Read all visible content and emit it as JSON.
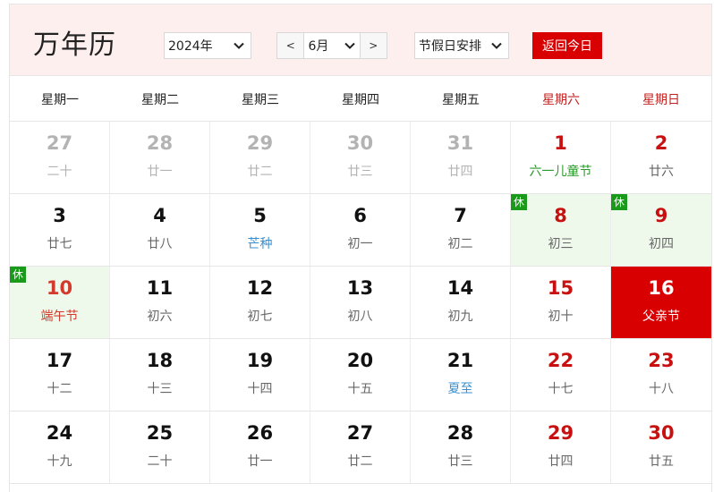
{
  "header": {
    "title": "万年历",
    "year_value": "2024年",
    "prev_month": "<",
    "month_value": "6月",
    "next_month": ">",
    "holiday_value": "节假日安排",
    "today_button": "返回今日"
  },
  "weekdays": [
    "星期一",
    "星期二",
    "星期三",
    "星期四",
    "星期五",
    "星期六",
    "星期日"
  ],
  "rest_badge": "休",
  "weeks": [
    [
      {
        "day": "27",
        "lunar": "二十"
      },
      {
        "day": "28",
        "lunar": "廿一"
      },
      {
        "day": "29",
        "lunar": "廿二"
      },
      {
        "day": "30",
        "lunar": "廿三"
      },
      {
        "day": "31",
        "lunar": "廿四"
      },
      {
        "day": "1",
        "lunar": "六一儿童节"
      },
      {
        "day": "2",
        "lunar": "廿六"
      }
    ],
    [
      {
        "day": "3",
        "lunar": "廿七"
      },
      {
        "day": "4",
        "lunar": "廿八"
      },
      {
        "day": "5",
        "lunar": "芒种"
      },
      {
        "day": "6",
        "lunar": "初一"
      },
      {
        "day": "7",
        "lunar": "初二"
      },
      {
        "day": "8",
        "lunar": "初三"
      },
      {
        "day": "9",
        "lunar": "初四"
      }
    ],
    [
      {
        "day": "10",
        "lunar": "端午节"
      },
      {
        "day": "11",
        "lunar": "初六"
      },
      {
        "day": "12",
        "lunar": "初七"
      },
      {
        "day": "13",
        "lunar": "初八"
      },
      {
        "day": "14",
        "lunar": "初九"
      },
      {
        "day": "15",
        "lunar": "初十"
      },
      {
        "day": "16",
        "lunar": "父亲节"
      }
    ],
    [
      {
        "day": "17",
        "lunar": "十二"
      },
      {
        "day": "18",
        "lunar": "十三"
      },
      {
        "day": "19",
        "lunar": "十四"
      },
      {
        "day": "20",
        "lunar": "十五"
      },
      {
        "day": "21",
        "lunar": "夏至"
      },
      {
        "day": "22",
        "lunar": "十七"
      },
      {
        "day": "23",
        "lunar": "十八"
      }
    ],
    [
      {
        "day": "24",
        "lunar": "十九"
      },
      {
        "day": "25",
        "lunar": "二十"
      },
      {
        "day": "26",
        "lunar": "廿一"
      },
      {
        "day": "27",
        "lunar": "廿二"
      },
      {
        "day": "28",
        "lunar": "廿三"
      },
      {
        "day": "29",
        "lunar": "廿四"
      },
      {
        "day": "30",
        "lunar": "廿五"
      }
    ]
  ],
  "colors": {
    "accent_red": "#d80000",
    "weekend_red": "#c81010",
    "holiday_bg": "#eef9ec",
    "rest_green": "#1a9a1a",
    "festival_green": "#2a9a2a",
    "solar_term_blue": "#3a8fcf",
    "header_bg": "#fcefed"
  }
}
